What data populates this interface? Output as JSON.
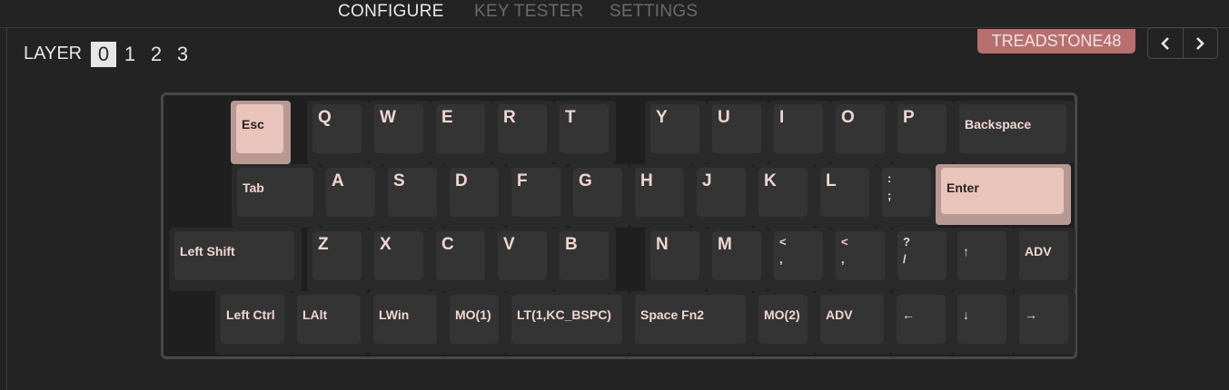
{
  "nav": {
    "configure": "CONFIGURE",
    "key_tester": "KEY TESTER",
    "settings": "SETTINGS"
  },
  "layers": {
    "label": "LAYER",
    "items": [
      "0",
      "1",
      "2",
      "3"
    ],
    "selected": "0"
  },
  "keyboard_name": "TREADSTONE48",
  "colors": {
    "background": "#232323",
    "accent": "#b8706f",
    "key_text": "#f0d6d1",
    "highlight_key": "#e8c4bb"
  },
  "keys": {
    "esc": "Esc",
    "q": "Q",
    "w": "W",
    "e": "E",
    "r": "R",
    "t": "T",
    "y": "Y",
    "u": "U",
    "i": "I",
    "o": "O",
    "p": "P",
    "backspace": "Backspace",
    "tab": "Tab",
    "a": "A",
    "s": "S",
    "d": "D",
    "f": "F",
    "g": "G",
    "h": "H",
    "j": "J",
    "k": "K",
    "l": "L",
    "semicolon": ":\n;",
    "enter": "Enter",
    "left_shift": "Left Shift",
    "z": "Z",
    "x": "X",
    "c": "C",
    "v": "V",
    "b": "B",
    "n": "N",
    "m": "M",
    "comma": "<\n,",
    "period": "<\n,",
    "slash": "?\n/",
    "up": "↑",
    "adv_top": "ADV",
    "left_ctrl": "Left Ctrl",
    "lalt": "LAlt",
    "lwin": "LWin",
    "mo1": "MO(1)",
    "lt": "LT(1,KC_BSPC)",
    "space_fn2": "Space Fn2",
    "mo2": "MO(2)",
    "adv_bottom": "ADV",
    "left": "←",
    "down": "↓",
    "right": "→"
  }
}
